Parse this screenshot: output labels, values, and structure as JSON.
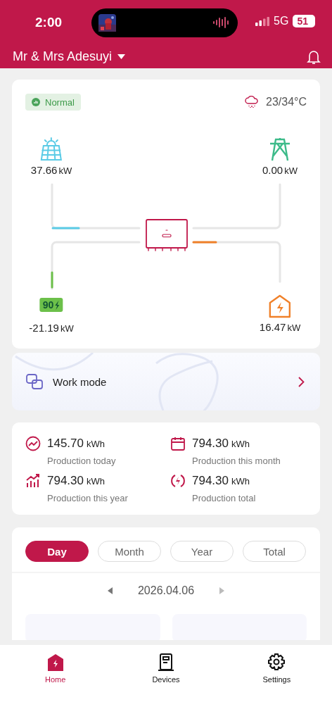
{
  "status_bar": {
    "time": "2:00",
    "network": "5G",
    "battery": "51"
  },
  "header": {
    "plant_name": "Mr & Mrs Adesuyi"
  },
  "overview": {
    "status": "Normal",
    "weather": "23/34°C",
    "nodes": [
      {
        "kind": "solar",
        "value": "37.66",
        "unit": "kW",
        "color": "#5bcbe6"
      },
      {
        "kind": "grid",
        "value": "0.00",
        "unit": "kW",
        "color": "#3dbb8a"
      },
      {
        "kind": "battery",
        "value": "-21.19",
        "unit": "kW",
        "soc": "90",
        "color": "#6cc04a"
      },
      {
        "kind": "home",
        "value": "16.47",
        "unit": "kW",
        "color": "#f0812a"
      }
    ]
  },
  "work_mode": {
    "label": "Work mode"
  },
  "production": [
    {
      "kind": "today",
      "value": "145.70",
      "unit": "kWh",
      "label": "Production today"
    },
    {
      "kind": "month",
      "value": "794.30",
      "unit": "kWh",
      "label": "Production this month"
    },
    {
      "kind": "year",
      "value": "794.30",
      "unit": "kWh",
      "label": "Production this year"
    },
    {
      "kind": "total",
      "value": "794.30",
      "unit": "kWh",
      "label": "Production total"
    }
  ],
  "period_tabs": [
    {
      "label": "Day",
      "selected": true
    },
    {
      "label": "Month",
      "selected": false
    },
    {
      "label": "Year",
      "selected": false
    },
    {
      "label": "Total",
      "selected": false
    }
  ],
  "date": "2026.04.06",
  "bottom_nav": [
    {
      "kind": "home",
      "label": "Home",
      "selected": true
    },
    {
      "kind": "devices",
      "label": "Devices",
      "selected": false
    },
    {
      "kind": "settings",
      "label": "Settings",
      "selected": false
    }
  ]
}
